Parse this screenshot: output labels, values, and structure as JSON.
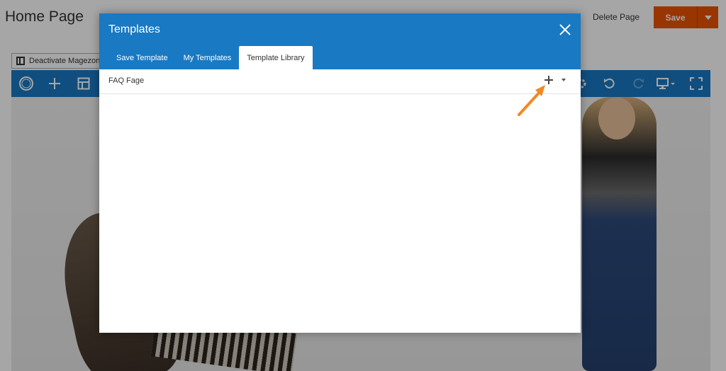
{
  "page": {
    "title": "Home Page",
    "delete_label": "Delete Page",
    "save_label": "Save"
  },
  "builder": {
    "deactivate_label": "Deactivate Magezon"
  },
  "modal": {
    "title": "Templates",
    "tabs": [
      {
        "label": "Save Template",
        "active": false
      },
      {
        "label": "My Templates",
        "active": false
      },
      {
        "label": "Template Library",
        "active": true
      }
    ],
    "rows": [
      {
        "title": "FAQ Fage"
      }
    ]
  },
  "colors": {
    "accent": "#1979c3",
    "save": "#eb5202",
    "annotation_arrow": "#f08a24"
  },
  "icons": [
    "close-icon",
    "plus-icon",
    "caret-down-icon",
    "logo-icon",
    "layout-icon",
    "undo-icon",
    "redo-icon",
    "monitor-icon",
    "fullscreen-icon",
    "settings-icon"
  ]
}
